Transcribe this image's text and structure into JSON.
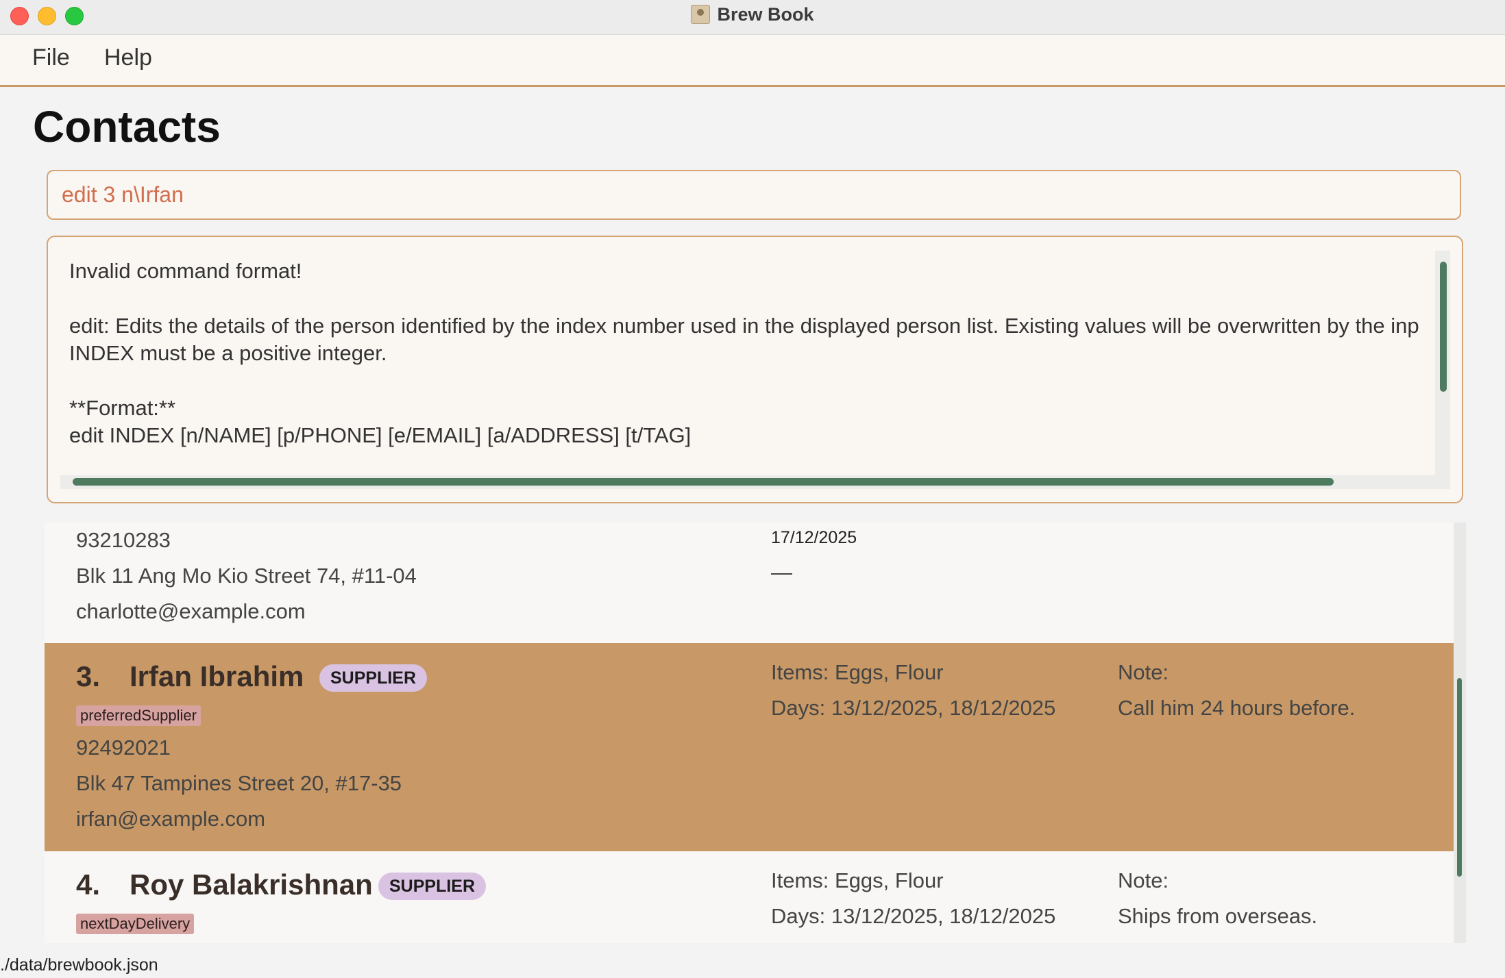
{
  "window": {
    "title": "Brew Book"
  },
  "menu": {
    "items": [
      "File",
      "Help"
    ]
  },
  "page": {
    "title": "Contacts"
  },
  "command": {
    "value": "edit 3 n\\Irfan"
  },
  "result": {
    "lines": [
      "Invalid command format!",
      "",
      "edit: Edits the details of the person identified by the index number used in the displayed person list. Existing values will be overwritten by the inp",
      "INDEX must be a positive integer.",
      "",
      "**Format:**",
      "edit INDEX [n/NAME] [p/PHONE] [e/EMAIL] [a/ADDRESS] [t/TAG]"
    ]
  },
  "contacts": [
    {
      "phone": "93210283",
      "address": "Blk 11 Ang Mo Kio Street 74, #11-04",
      "email": "charlotte@example.com",
      "date": "17/12/2025",
      "dash": "—"
    },
    {
      "index": "3.",
      "name": "Irfan Ibrahim",
      "role": "SUPPLIER",
      "tag": "preferredSupplier",
      "phone": "92492021",
      "address": "Blk 47 Tampines Street 20, #17-35",
      "email": "irfan@example.com",
      "items": "Items:  Eggs, Flour",
      "days": "Days:  13/12/2025, 18/12/2025",
      "note_label": "Note:",
      "note": "Call him 24 hours before."
    },
    {
      "index": "4.",
      "name": "Roy Balakrishnan",
      "role": "SUPPLIER",
      "tag": "nextDayDelivery",
      "items": "Items:  Eggs, Flour",
      "days": "Days:  13/12/2025, 18/12/2025",
      "note_label": "Note:",
      "note": "Ships from overseas."
    }
  ],
  "status": {
    "path": "./data/brewbook.json"
  },
  "colors": {
    "accent": "#c89964",
    "selected_row": "#c89966",
    "scrollbar": "#4e7a5f",
    "badge": "#d9c2e2",
    "tag": "#d7a3a0",
    "command_text": "#cf6e4e"
  }
}
